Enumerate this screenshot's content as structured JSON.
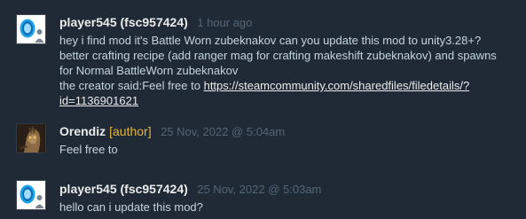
{
  "comments": [
    {
      "author": "player545 (fsc957424)",
      "author_tag": "",
      "timestamp": "1 hour ago",
      "avatar_icon": "portal-icon",
      "lines": [
        "hey i find mod it's Battle Worn zubeknakov can you update this mod to unity3.28+?",
        "better crafting recipe (add ranger mag for crafting makeshift zubeknakov) and spawns",
        "for Normal BattleWorn zubeknakov"
      ],
      "creator_prefix": "the creator said:Feel free to ",
      "link_line1": "https://steamcommunity.com/sharedfiles/filedetails/?",
      "link_line2": "id=1136901621"
    },
    {
      "author": "Orendiz",
      "author_tag": "[author]",
      "timestamp": "25 Nov, 2022 @ 5:04am",
      "avatar_icon": "creature-avatar-icon",
      "text": "Feel free to"
    },
    {
      "author": "player545 (fsc957424)",
      "author_tag": "",
      "timestamp": "25 Nov, 2022 @ 5:03am",
      "avatar_icon": "portal-icon",
      "text": "hello can i update this mod?"
    }
  ],
  "colors": {
    "background": "#1f2a36",
    "author": "#ebebeb",
    "author_tag": "#e1b542",
    "timestamp": "#556576",
    "text": "#c6d4df"
  }
}
